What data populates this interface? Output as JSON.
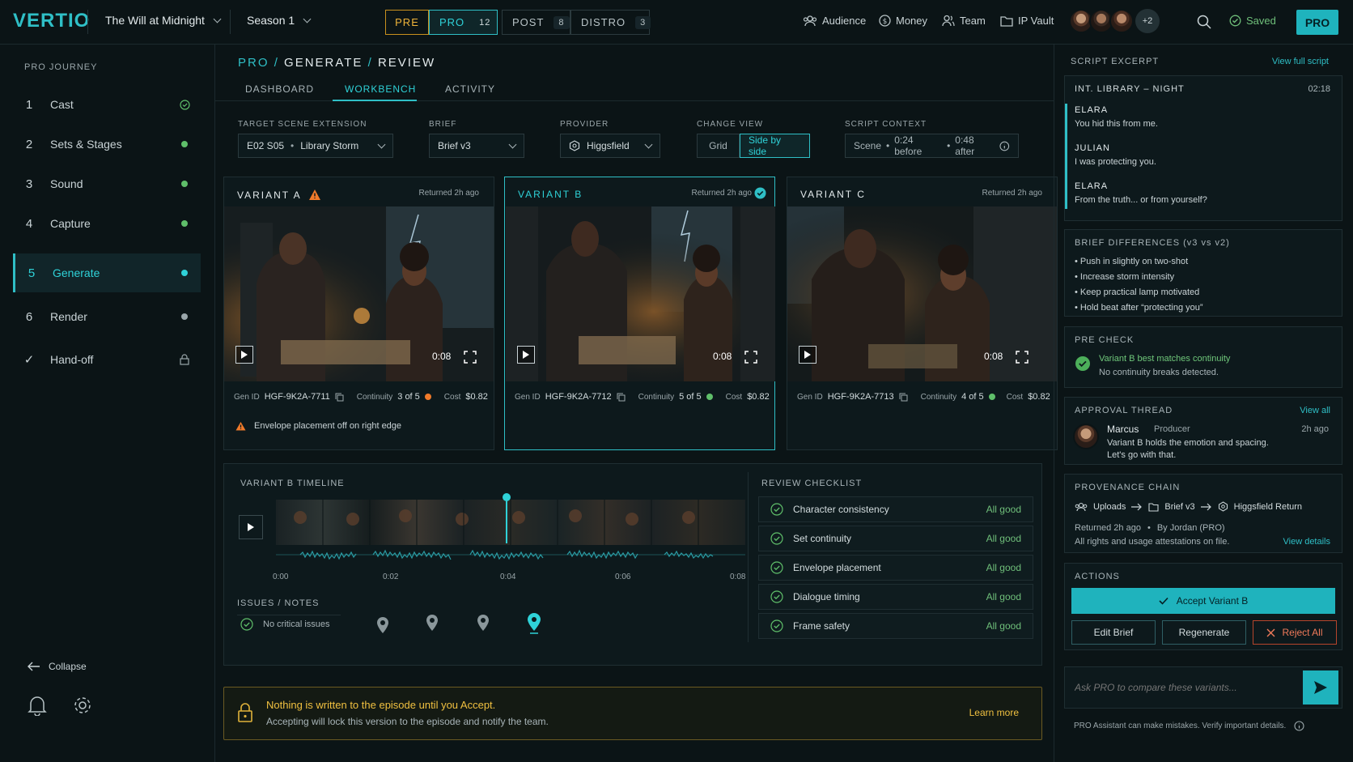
{
  "app": {
    "logo": "VERTIO",
    "project": "The Will at Midnight",
    "season": "Season 1"
  },
  "phases": [
    {
      "label": "PRE",
      "count": ""
    },
    {
      "label": "PRO",
      "count": "12"
    },
    {
      "label": "POST",
      "count": "8"
    },
    {
      "label": "DISTRO",
      "count": "3"
    }
  ],
  "topnav": {
    "audience": "Audience",
    "money": "Money",
    "team": "Team",
    "ipvault": "IP Vault",
    "more_avatars": "+2",
    "saved": "Saved",
    "pro": "PRO"
  },
  "sidebar": {
    "header": "PRO JOURNEY",
    "steps": [
      {
        "num": "1",
        "label": "Cast",
        "status": "done"
      },
      {
        "num": "2",
        "label": "Sets & Stages",
        "status": "ok"
      },
      {
        "num": "3",
        "label": "Sound",
        "status": "ok"
      },
      {
        "num": "4",
        "label": "Capture",
        "status": "ok"
      },
      {
        "num": "5",
        "label": "Generate",
        "status": "active"
      },
      {
        "num": "6",
        "label": "Render",
        "status": "pending"
      },
      {
        "num": "✓",
        "label": "Hand-off",
        "status": "locked"
      }
    ],
    "collapse": "Collapse"
  },
  "breadcrumb": {
    "a": "PRO",
    "sep": "/",
    "b": "GENERATE",
    "c": "REVIEW"
  },
  "tabs": [
    "DASHBOARD",
    "WORKBENCH",
    "ACTIVITY"
  ],
  "filters": {
    "scene_label": "TARGET SCENE EXTENSION",
    "scene_code": "E02 S05",
    "scene_name": "Library Storm",
    "brief_label": "BRIEF",
    "brief": "Brief v3",
    "provider_label": "PROVIDER",
    "provider": "Higgsfield",
    "view_label": "CHANGE VIEW",
    "view_grid": "Grid",
    "view_side": "Side by side",
    "context_label": "SCRIPT CONTEXT",
    "context_scene": "Scene",
    "context_before": "0:24 before",
    "context_after": "0:48 after"
  },
  "variants": [
    {
      "title": "VARIANT A",
      "returned": "Returned 2h ago",
      "duration": "0:08",
      "gen_label": "Gen ID",
      "gen_id": "HGF-9K2A-7711",
      "cont_label": "Continuity",
      "cont": "3 of 5",
      "cost_label": "Cost",
      "cost": "$0.82",
      "warning": "Envelope placement off on right edge"
    },
    {
      "title": "VARIANT B",
      "returned": "Returned 2h ago",
      "duration": "0:08",
      "gen_label": "Gen ID",
      "gen_id": "HGF-9K2A-7712",
      "cont_label": "Continuity",
      "cont": "5 of 5",
      "cost_label": "Cost",
      "cost": "$0.82"
    },
    {
      "title": "VARIANT C",
      "returned": "Returned 2h ago",
      "duration": "0:08",
      "gen_label": "Gen ID",
      "gen_id": "HGF-9K2A-7713",
      "cont_label": "Continuity",
      "cont": "4 of 5",
      "cost_label": "Cost",
      "cost": "$0.82"
    }
  ],
  "timeline": {
    "title": "VARIANT B TIMELINE",
    "ticks": [
      "0:00",
      "0:02",
      "0:04",
      "0:06",
      "0:08"
    ],
    "playhead": 0.49,
    "issues_title": "ISSUES / NOTES",
    "no_issues": "No critical issues"
  },
  "checklist": {
    "title": "REVIEW CHECKLIST",
    "items": [
      {
        "label": "Character consistency",
        "status": "All good"
      },
      {
        "label": "Set continuity",
        "status": "All good"
      },
      {
        "label": "Envelope placement",
        "status": "All good"
      },
      {
        "label": "Dialogue timing",
        "status": "All good"
      },
      {
        "label": "Frame safety",
        "status": "All good"
      }
    ]
  },
  "banner": {
    "title": "Nothing is written to the episode until you Accept.",
    "body": "Accepting will lock this version to the episode and notify the team.",
    "link": "Learn more"
  },
  "script": {
    "title": "SCRIPT EXCERPT",
    "link": "View full script",
    "slug": "INT. LIBRARY – NIGHT",
    "time": "02:18",
    "lines": [
      {
        "who": "ELARA",
        "text": "You hid this from me."
      },
      {
        "who": "JULIAN",
        "text": "I was protecting you."
      },
      {
        "who": "ELARA",
        "text": "From the truth... or from yourself?"
      }
    ]
  },
  "brief_diff": {
    "title": "BRIEF DIFFERENCES (v3 vs v2)",
    "items": [
      "Push in slightly on two-shot",
      "Increase storm intensity",
      "Keep practical lamp motivated",
      "Hold beat after “protecting you”"
    ]
  },
  "precheck": {
    "title": "PRE CHECK",
    "line1": "Variant B best matches continuity",
    "line2": "No continuity breaks detected."
  },
  "approval": {
    "title": "APPROVAL THREAD",
    "link": "View all",
    "name": "Marcus",
    "role": "Producer",
    "time": "2h ago",
    "msg1": "Variant B holds the emotion and spacing.",
    "msg2": "Let's go with that."
  },
  "provenance": {
    "title": "PROVENANCE CHAIN",
    "a": "Uploads",
    "b": "Brief v3",
    "c": "Higgsfield Return",
    "returned": "Returned 2h ago",
    "by": "By Jordan (PRO)",
    "rights": "All rights and usage attestations on file.",
    "link": "View details"
  },
  "actions": {
    "title": "ACTIONS",
    "accept": "Accept Variant B",
    "edit": "Edit Brief",
    "regen": "Regenerate",
    "reject": "Reject All"
  },
  "assistant": {
    "placeholder": "Ask PRO to compare these variants...",
    "disclaimer": "PRO Assistant can make mistakes. Verify important details."
  },
  "colors": {
    "accent": "#2fbfc6",
    "ok": "#5fbf6a",
    "warn": "#f07a2a",
    "gold": "#e0b23a"
  }
}
